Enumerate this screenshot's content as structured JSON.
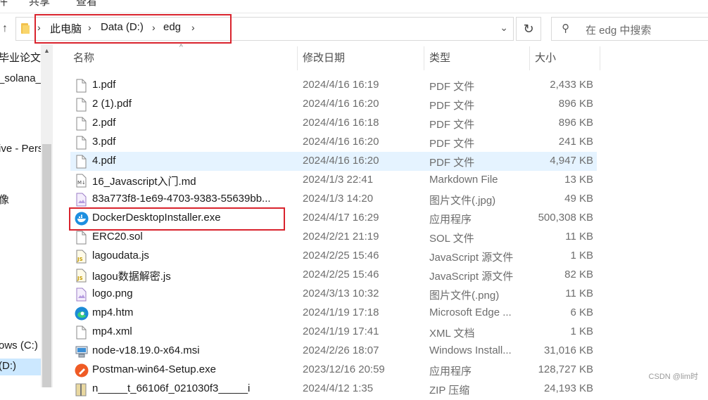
{
  "ribbon": {
    "tabs": [
      "件",
      "共享",
      "查看"
    ]
  },
  "address": {
    "crumbs": [
      "此电脑",
      "Data (D:)",
      "edg"
    ],
    "search_placeholder": "在 edg 中搜索"
  },
  "nav": {
    "items": [
      "毕业论文相",
      "_solana_",
      "ive - Pers",
      "像",
      "ows (C:)",
      "(D:)"
    ]
  },
  "columns": {
    "name": "名称",
    "date": "修改日期",
    "type": "类型",
    "size": "大小"
  },
  "files": [
    {
      "name": "1.pdf",
      "date": "2024/4/16 16:19",
      "type": "PDF 文件",
      "size": "2,433 KB",
      "icon": "document-icon"
    },
    {
      "name": "2 (1).pdf",
      "date": "2024/4/16 16:20",
      "type": "PDF 文件",
      "size": "896 KB",
      "icon": "document-icon"
    },
    {
      "name": "2.pdf",
      "date": "2024/4/16 16:18",
      "type": "PDF 文件",
      "size": "896 KB",
      "icon": "document-icon"
    },
    {
      "name": "3.pdf",
      "date": "2024/4/16 16:20",
      "type": "PDF 文件",
      "size": "241 KB",
      "icon": "document-icon"
    },
    {
      "name": "4.pdf",
      "date": "2024/4/16 16:20",
      "type": "PDF 文件",
      "size": "4,947 KB",
      "icon": "document-icon"
    },
    {
      "name": "16_Javascript入门.md",
      "date": "2024/1/3 22:41",
      "type": "Markdown File",
      "size": "13 KB",
      "icon": "markdown-icon"
    },
    {
      "name": "83a773f8-1e69-4703-9383-55639bb...",
      "date": "2024/1/3 14:20",
      "type": "图片文件(.jpg)",
      "size": "49 KB",
      "icon": "image-icon"
    },
    {
      "name": "DockerDesktopInstaller.exe",
      "date": "2024/4/17 16:29",
      "type": "应用程序",
      "size": "500,308 KB",
      "icon": "docker-icon"
    },
    {
      "name": "ERC20.sol",
      "date": "2024/2/21 21:19",
      "type": "SOL 文件",
      "size": "11 KB",
      "icon": "document-icon"
    },
    {
      "name": "lagoudata.js",
      "date": "2024/2/25 15:46",
      "type": "JavaScript 源文件",
      "size": "1 KB",
      "icon": "js-icon"
    },
    {
      "name": "lagou数据解密.js",
      "date": "2024/2/25 15:46",
      "type": "JavaScript 源文件",
      "size": "82 KB",
      "icon": "js-icon"
    },
    {
      "name": "logo.png",
      "date": "2024/3/13 10:32",
      "type": "图片文件(.png)",
      "size": "11 KB",
      "icon": "image-icon"
    },
    {
      "name": "mp4.htm",
      "date": "2024/1/19 17:18",
      "type": "Microsoft Edge ...",
      "size": "6 KB",
      "icon": "edge-icon"
    },
    {
      "name": "mp4.xml",
      "date": "2024/1/19 17:41",
      "type": "XML 文档",
      "size": "1 KB",
      "icon": "document-icon"
    },
    {
      "name": "node-v18.19.0-x64.msi",
      "date": "2024/2/26 18:07",
      "type": "Windows Install...",
      "size": "31,016 KB",
      "icon": "installer-icon"
    },
    {
      "name": "Postman-win64-Setup.exe",
      "date": "2023/12/16 20:59",
      "type": "应用程序",
      "size": "128,727 KB",
      "icon": "postman-icon"
    },
    {
      "name": "n_____t_66106f_021030f3_____i",
      "date": "2024/4/12 1:35",
      "type": "ZIP 压缩",
      "size": "24,193 KB",
      "icon": "zip-icon"
    }
  ],
  "watermark": "CSDN @lim时",
  "colors": {
    "selection": "#e5f3ff",
    "highlight_border": "#d9232d",
    "nav_selected": "#cce8ff"
  }
}
